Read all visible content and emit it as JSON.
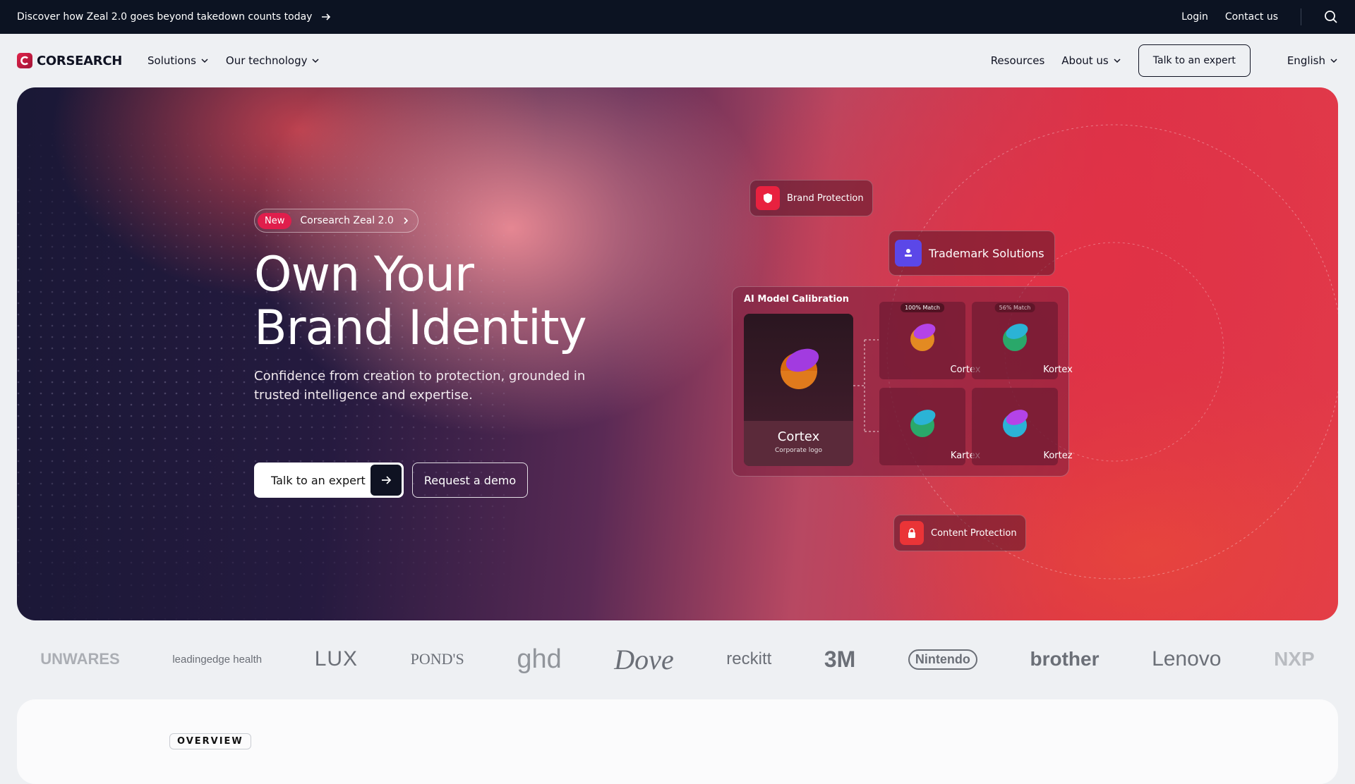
{
  "topbar": {
    "promo_text": "Discover how Zeal 2.0 goes beyond takedown counts today",
    "login": "Login",
    "contact": "Contact us"
  },
  "nav": {
    "logo_text": "CORSEARCH",
    "solutions": "Solutions",
    "technology": "Our technology",
    "resources": "Resources",
    "about": "About us",
    "talk": "Talk to an expert",
    "language": "English"
  },
  "hero": {
    "badge_new": "New",
    "badge_text": "Corsearch Zeal 2.0",
    "title_line1": "Own Your",
    "title_line2": "Brand Identity",
    "subtitle": "Confidence from creation to protection, grounded in trusted intelligence and expertise.",
    "cta_primary": "Talk to an expert",
    "cta_secondary": "Request a demo"
  },
  "visual": {
    "brand_protection": "Brand Protection",
    "trademark_solutions": "Trademark Solutions",
    "content_protection": "Content Protection",
    "panel_title": "AI Model Calibration",
    "main_name": "Cortex",
    "main_caption": "Corporate logo",
    "matches": [
      {
        "tag": "100% Match",
        "name": "Cortex"
      },
      {
        "tag": "56% Match",
        "name": "Kortex"
      },
      {
        "tag": "",
        "name": "Kartex"
      },
      {
        "tag": "",
        "name": "Kortez"
      }
    ]
  },
  "logos": [
    "UNWARES",
    "leadingedge health",
    "LUX",
    "POND'S",
    "ghd",
    "Dove",
    "reckitt",
    "3M",
    "Nintendo",
    "brother",
    "Lenovo",
    "NXP"
  ],
  "overview": {
    "label": "OVERVIEW"
  },
  "colors": {
    "brand": "#e01e4c",
    "dark": "#0c1322"
  }
}
